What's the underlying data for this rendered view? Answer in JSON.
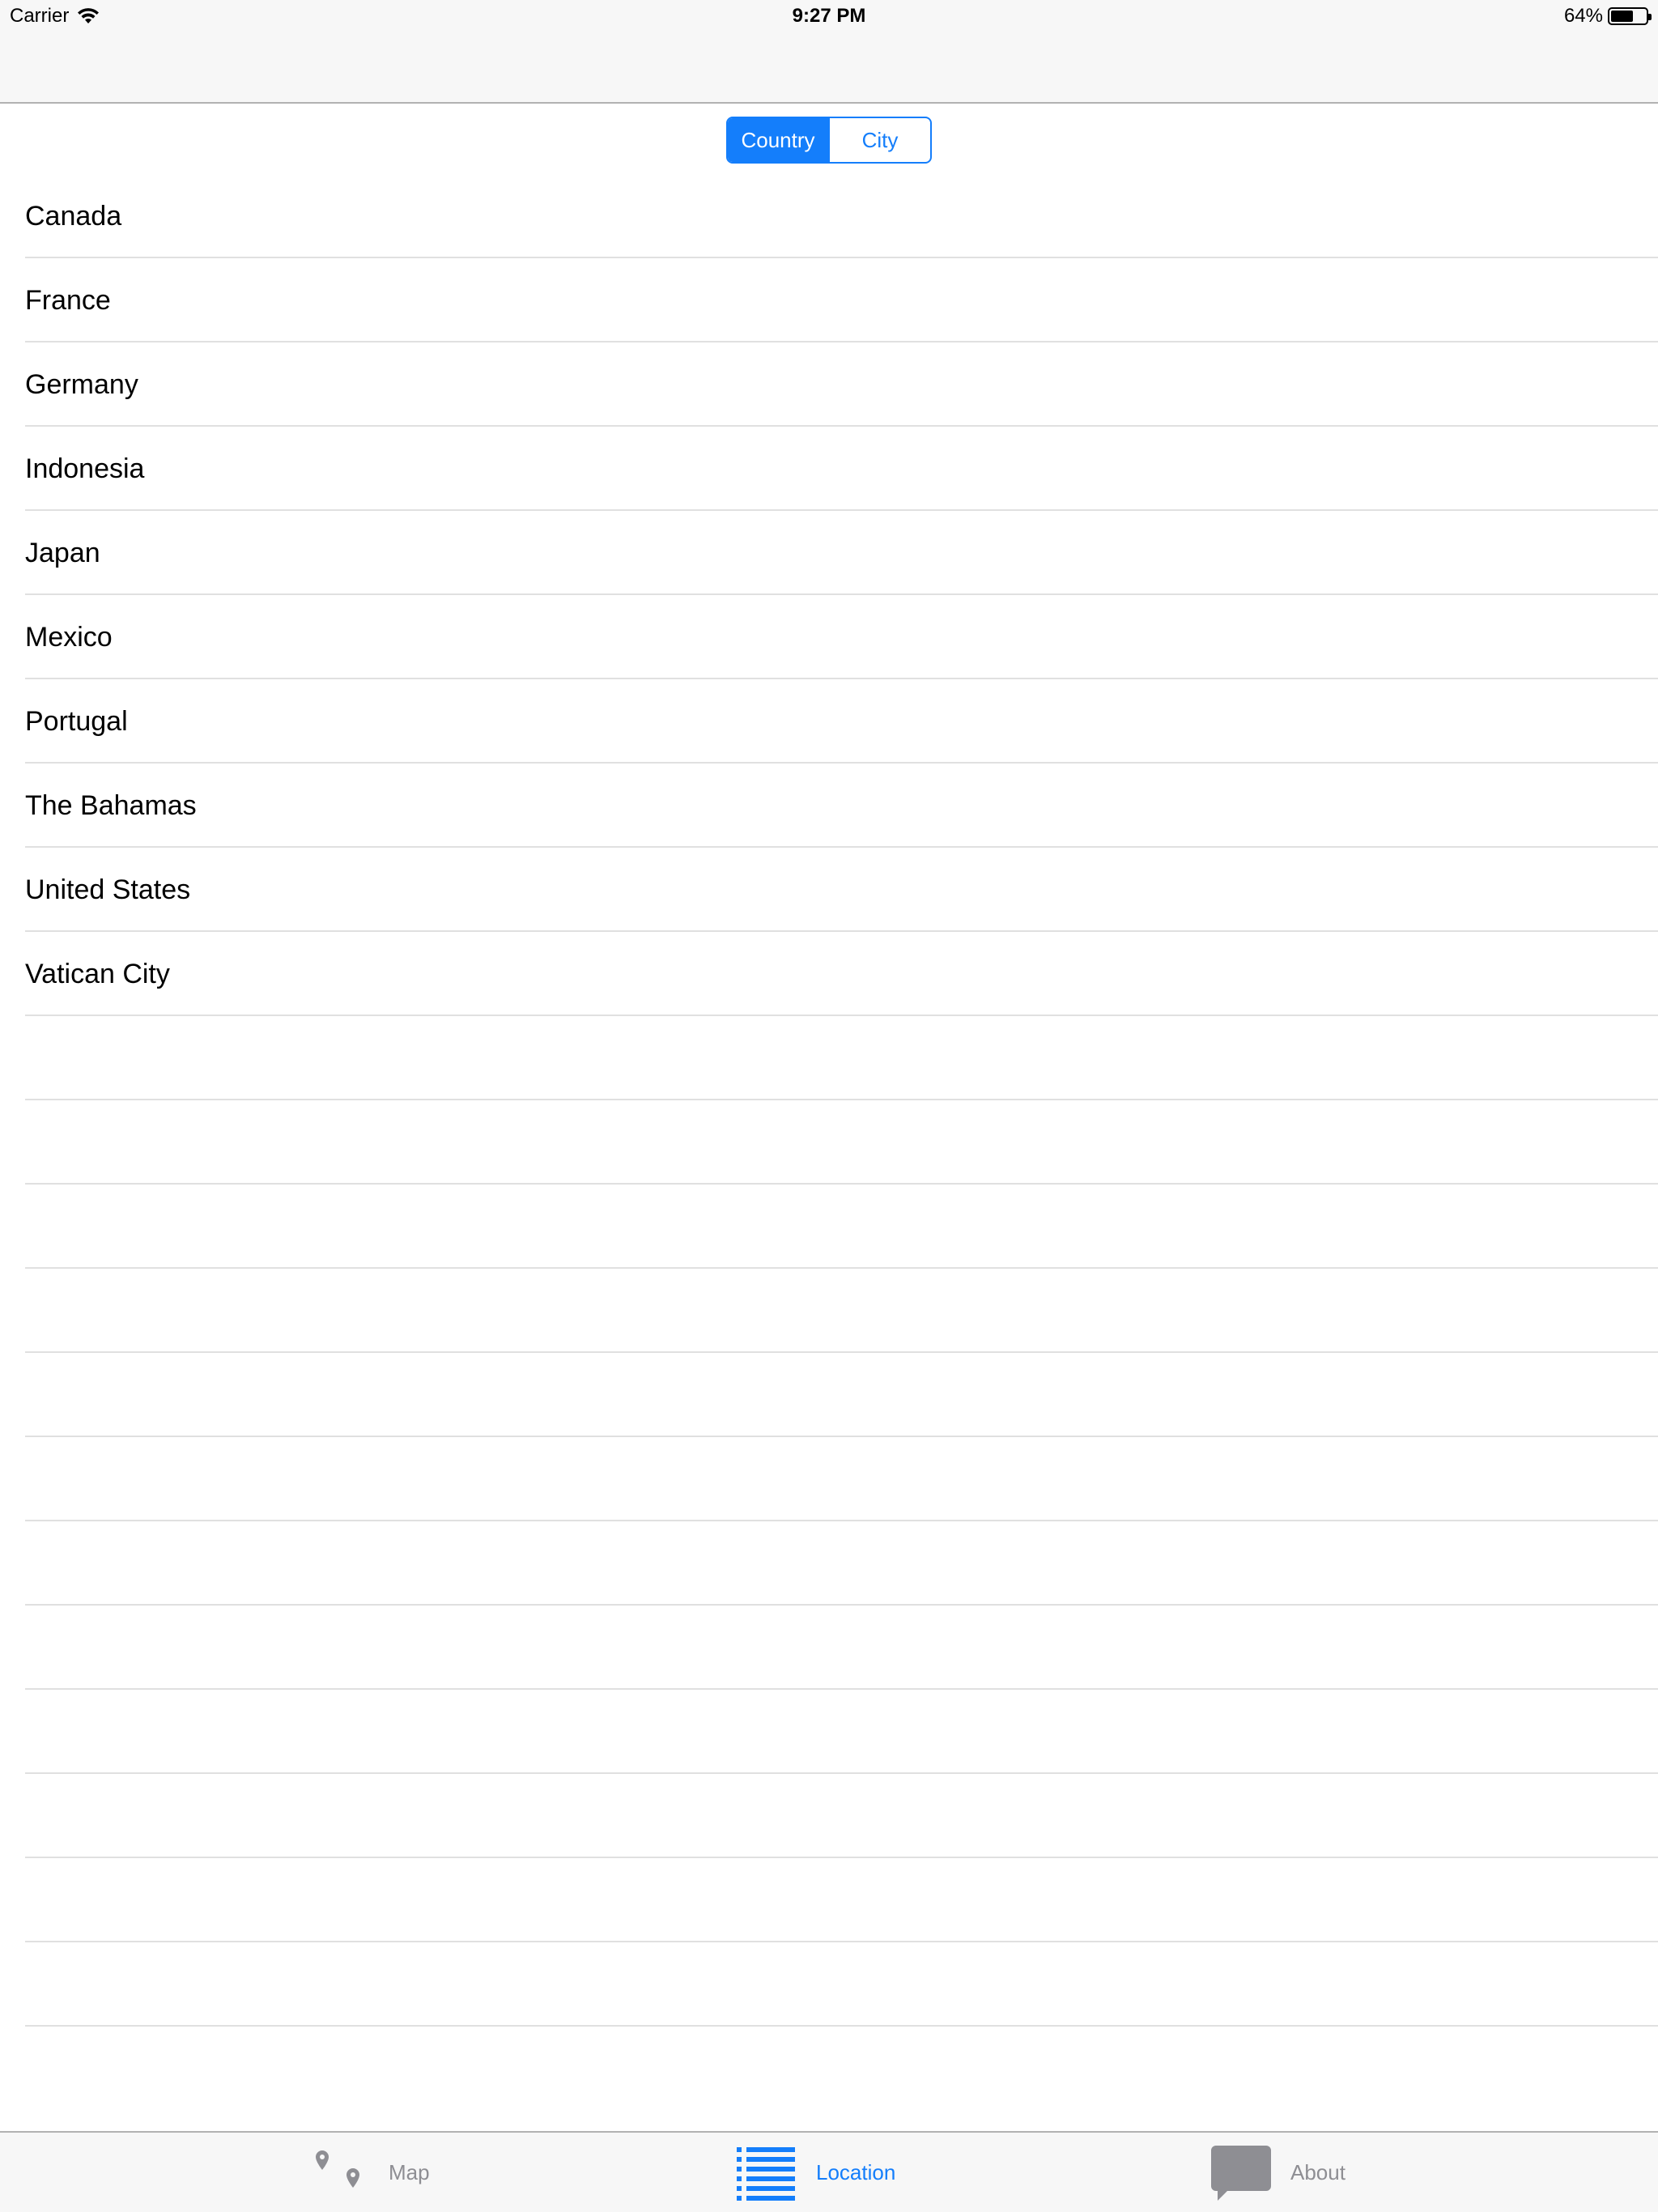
{
  "status_bar": {
    "carrier": "Carrier",
    "time": "9:27 PM",
    "battery_percent": "64%",
    "battery_level": 0.64
  },
  "segmented_control": {
    "options": [
      "Country",
      "City"
    ],
    "selected": "Country"
  },
  "countries": [
    "Canada",
    "France",
    "Germany",
    "Indonesia",
    "Japan",
    "Mexico",
    "Portugal",
    "The Bahamas",
    "United States",
    "Vatican City"
  ],
  "tab_bar": {
    "tabs": [
      {
        "label": "Map",
        "icon": "map-pins-icon",
        "active": false
      },
      {
        "label": "Location",
        "icon": "list-icon",
        "active": true
      },
      {
        "label": "About",
        "icon": "speech-bubble-icon",
        "active": false
      }
    ]
  },
  "colors": {
    "accent": "#147efb",
    "inactive": "#8e8e93",
    "bar_background": "#f7f7f7",
    "separator": "#e0e0e0"
  }
}
